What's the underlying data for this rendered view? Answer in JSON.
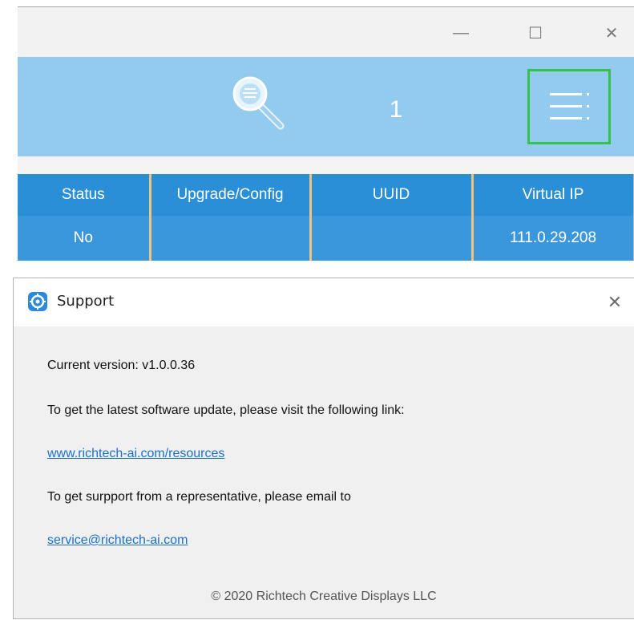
{
  "app_window": {
    "controls": {
      "minimize": "—",
      "maximize": "☐",
      "close": "✕"
    },
    "toolbar": {
      "search_icon": "magnifier-icon",
      "device_count": "1",
      "menu_icon": "menu-icon",
      "background_color": "#92cbee",
      "menu_highlight_color": "#35c24b"
    },
    "table": {
      "columns": [
        "Status",
        "Upgrade/Config",
        "UUID",
        "Virtual IP"
      ],
      "rows": [
        [
          "No",
          "",
          "",
          "111.0.29.208"
        ]
      ]
    }
  },
  "support_dialog": {
    "title": "Support",
    "close": "✕",
    "current_version": "Current version: v1.0.0.36",
    "update_text": "To get the latest software update, please visit the following link:",
    "resources_link": "www.richtech-ai.com/resources",
    "support_text": "To get surpport from a representative, please email to",
    "email_link": "service@richtech-ai.com",
    "copyright": "© 2020 Richtech Creative Displays LLC",
    "link_color": "#1a6fd0"
  }
}
